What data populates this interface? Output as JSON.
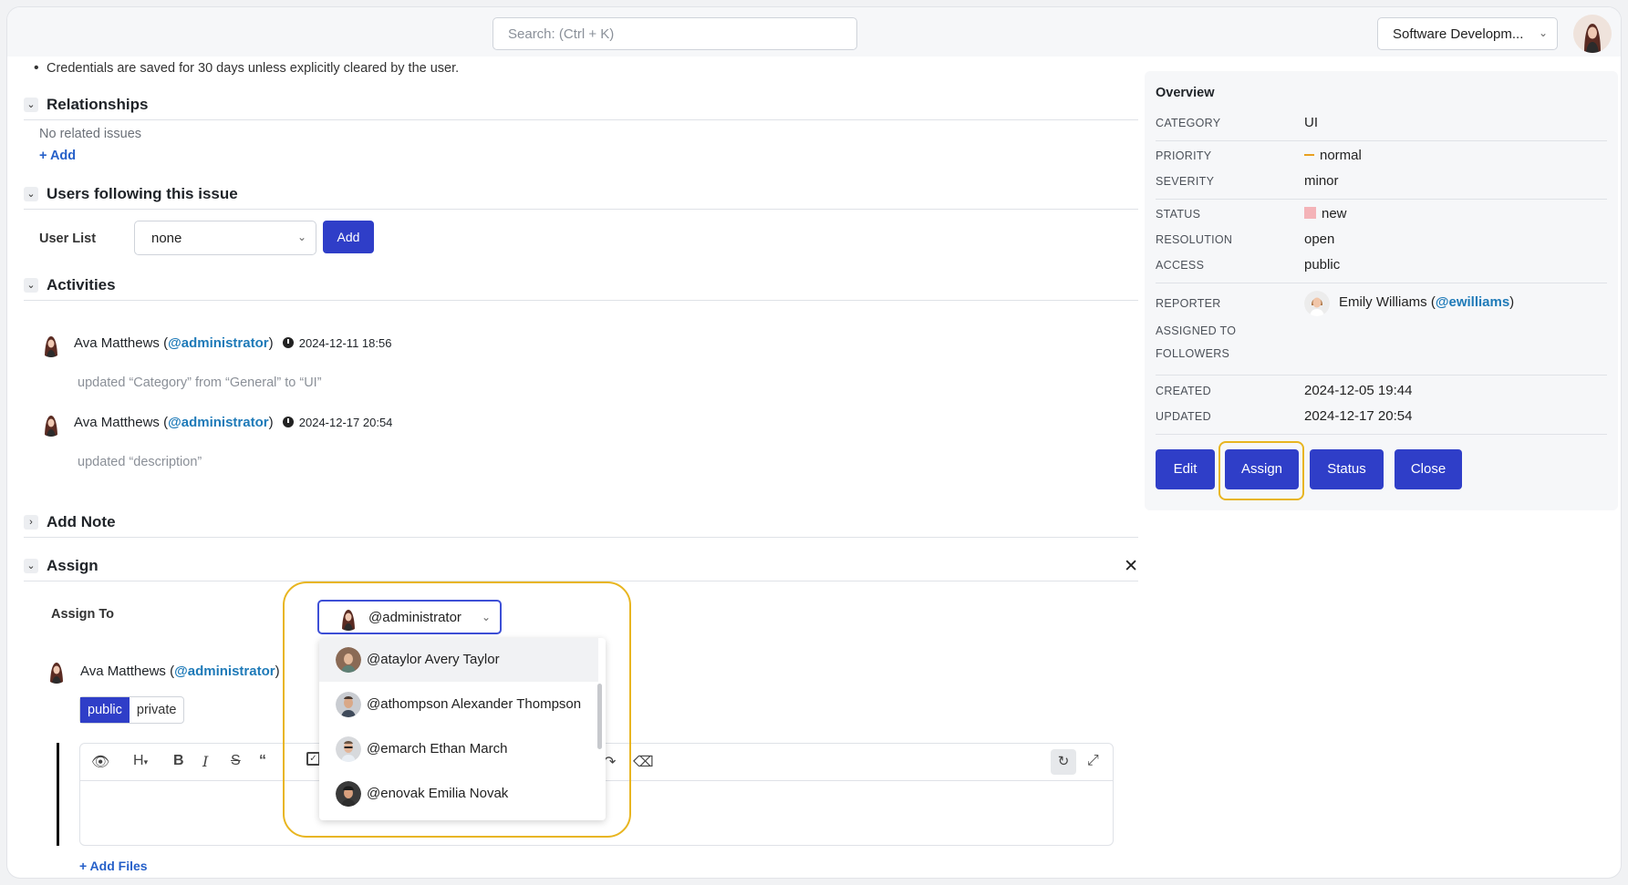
{
  "header": {
    "search_placeholder": "Search: (Ctrl + K)",
    "project": "Software Developm...",
    "user_avatar": "woman-avatar"
  },
  "description": {
    "bullet": "Credentials are saved for 30 days unless explicitly cleared by the user."
  },
  "relationships": {
    "title": "Relationships",
    "empty": "No related issues",
    "add_label": "+ Add"
  },
  "followers": {
    "title": "Users following this issue",
    "user_list_label": "User List",
    "selected": "none",
    "add_label": "Add"
  },
  "activities": {
    "title": "Activities",
    "items": [
      {
        "user": "Ava Matthews",
        "handle": "@administrator",
        "time": "2024-12-11 18:56",
        "text": "updated “Category” from “General” to “UI”"
      },
      {
        "user": "Ava Matthews",
        "handle": "@administrator",
        "time": "2024-12-17 20:54",
        "text": "updated “description”"
      }
    ]
  },
  "add_note": {
    "title": "Add Note"
  },
  "assign": {
    "title": "Assign",
    "assign_to_label": "Assign To",
    "selected": "@administrator",
    "note_user": "Ava Matthews",
    "note_handle": "@administrator",
    "visibility_public": "public",
    "visibility_private": "private",
    "add_files": "+ Add Files",
    "options": [
      {
        "handle": "@ataylor",
        "name": "Avery Taylor"
      },
      {
        "handle": "@athompson",
        "name": "Alexander Thompson"
      },
      {
        "handle": "@emarch",
        "name": "Ethan March"
      },
      {
        "handle": "@enovak",
        "name": "Emilia Novak"
      }
    ]
  },
  "overview": {
    "title": "Overview",
    "category_label": "CATEGORY",
    "category": "UI",
    "priority_label": "PRIORITY",
    "priority": "normal",
    "severity_label": "SEVERITY",
    "severity": "minor",
    "status_label": "STATUS",
    "status": "new",
    "resolution_label": "RESOLUTION",
    "resolution": "open",
    "access_label": "ACCESS",
    "access": "public",
    "reporter_label": "REPORTER",
    "reporter_name": "Emily Williams",
    "reporter_handle": "@ewilliams",
    "assigned_label": "ASSIGNED TO",
    "followers_label": "FOLLOWERS",
    "created_label": "CREATED",
    "created": "2024-12-05 19:44",
    "updated_label": "UPDATED",
    "updated": "2024-12-17 20:54",
    "buttons": {
      "edit": "Edit",
      "assign": "Assign",
      "status": "Status",
      "close": "Close"
    }
  },
  "colors": {
    "primary_button": "#2f3ec8",
    "highlight": "#e8b520",
    "priority_normal": "#e8a020",
    "status_new": "#f4b3b8",
    "handle_link": "#1e7ab8"
  }
}
